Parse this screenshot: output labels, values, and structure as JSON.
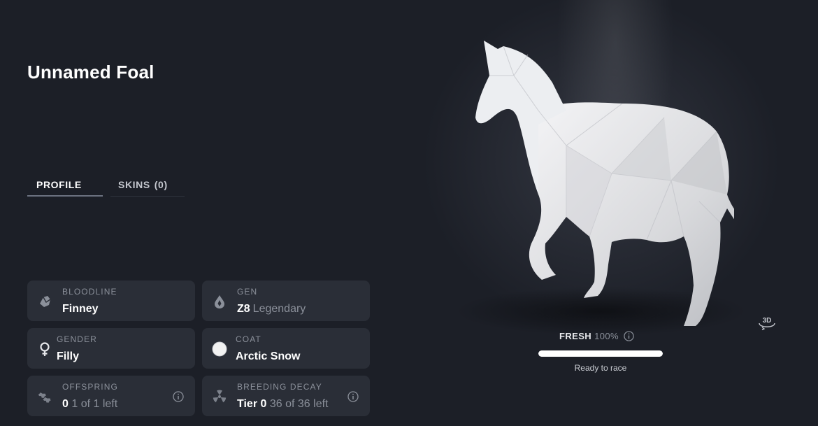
{
  "horse": {
    "name": "Unnamed Foal"
  },
  "tabs": [
    {
      "label": "PROFILE"
    },
    {
      "label": "SKINS",
      "count": "(0)"
    }
  ],
  "cards": {
    "bloodline": {
      "label": "BLOODLINE",
      "value": "Finney",
      "icon": "horse-head-icon"
    },
    "gen": {
      "label": "GEN",
      "value": "Z8",
      "secondary": "Legendary",
      "icon": "drop-icon"
    },
    "gender": {
      "label": "GENDER",
      "value": "Filly",
      "icon": "female-icon"
    },
    "coat": {
      "label": "COAT",
      "value": "Arctic Snow",
      "icon": "coat-color-swatch",
      "swatch_color": "#f2f2f2"
    },
    "offspring": {
      "label": "OFFSPRING",
      "value": "0",
      "secondary": "1 of 1 left",
      "icon": "horses-icon"
    },
    "breeding_decay": {
      "label": "BREEDING DECAY",
      "value": "Tier 0",
      "secondary": "36 of 36 left",
      "icon": "radiation-icon"
    }
  },
  "status": {
    "label": "FRESH",
    "percent_text": "100%",
    "fill_percent": 100,
    "caption": "Ready to race"
  },
  "view_toggle": {
    "label": "3D"
  }
}
